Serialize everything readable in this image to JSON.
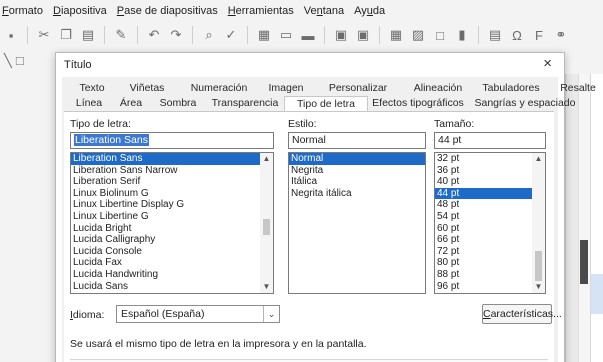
{
  "app": {
    "menus": [
      {
        "pre": "",
        "key": "F",
        "post": "ormato"
      },
      {
        "pre": "",
        "key": "D",
        "post": "iapositiva"
      },
      {
        "pre": "",
        "key": "P",
        "post": "ase de diapositivas"
      },
      {
        "pre": "",
        "key": "H",
        "post": "erramientas"
      },
      {
        "pre": "Ve",
        "key": "n",
        "post": "tana"
      },
      {
        "pre": "Ay",
        "key": "u",
        "post": "da"
      }
    ]
  },
  "dialog": {
    "title": "Título",
    "close_glyph": "×",
    "tabs_row1": [
      "Texto",
      "Viñetas",
      "Numeración",
      "Imagen",
      "Personalizar",
      "Alineación",
      "Tabuladores",
      "Resalte"
    ],
    "tabs_row2": [
      "Línea",
      "Área",
      "Sombra",
      "Transparencia",
      "Tipo de letra",
      "Efectos tipográficos",
      "Sangrías y espaciado"
    ],
    "active_tab": "Tipo de letra",
    "font": {
      "label": "Tipo de letra:",
      "value": "Liberation Sans",
      "items": [
        "Liberation Sans",
        "Liberation Sans Narrow",
        "Liberation Serif",
        "Linux Biolinum G",
        "Linux Libertine Display G",
        "Linux Libertine G",
        "Lucida Bright",
        "Lucida Calligraphy",
        "Lucida Console",
        "Lucida Fax",
        "Lucida Handwriting",
        "Lucida Sans"
      ],
      "selected_index": 0
    },
    "style": {
      "label": "Estilo:",
      "value": "Normal",
      "items": [
        "Normal",
        "Negrita",
        "Itálica",
        "Negrita itálica"
      ],
      "selected_index": 0
    },
    "size": {
      "label": "Tamaño:",
      "value": "44 pt",
      "items": [
        "32 pt",
        "36 pt",
        "40 pt",
        "44 pt",
        "48 pt",
        "54 pt",
        "60 pt",
        "66 pt",
        "72 pt",
        "80 pt",
        "88 pt",
        "96 pt"
      ],
      "selected_index": 3
    },
    "language": {
      "label_pre": "",
      "label_key": "I",
      "label_post": "dioma:",
      "value": "Español (España)"
    },
    "features_button": {
      "pre": "",
      "key": "C",
      "post": "aracterísticas..."
    },
    "info_text": "Se usará el mismo tipo de letra en la impresora y en la pantalla."
  }
}
